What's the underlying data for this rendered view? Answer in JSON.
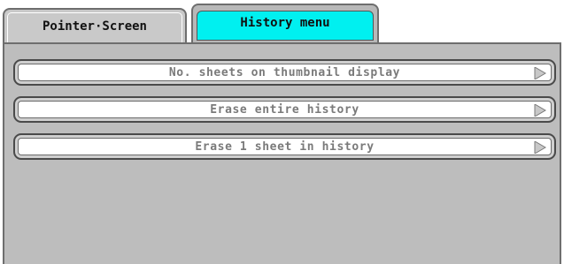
{
  "tabs": {
    "pointer_screen": "Pointer·Screen",
    "history_menu": "History menu"
  },
  "menu": {
    "items": [
      {
        "label": "No. sheets on thumbnail display",
        "icon": "arrow-right-icon"
      },
      {
        "label": "Erase entire history",
        "icon": "arrow-right-icon"
      },
      {
        "label": "Erase 1 sheet in history",
        "icon": "arrow-right-icon"
      }
    ]
  },
  "colors": {
    "active_tab": "#00f0f0",
    "panel": "#bdbdbd",
    "inactive_tab": "#c9c9c9",
    "button_text": "#7a7a7a"
  }
}
